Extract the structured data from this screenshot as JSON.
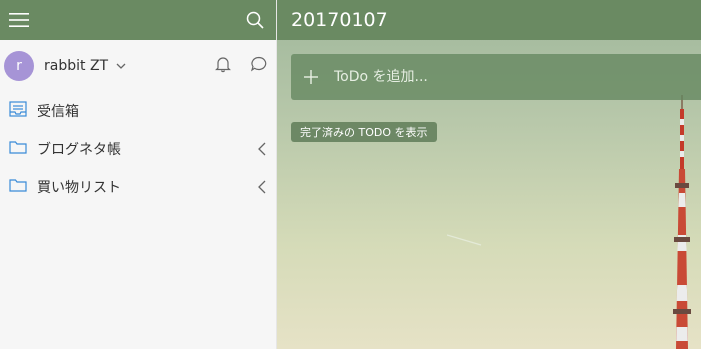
{
  "sidebar": {
    "user": {
      "initial": "r",
      "name": "rabbit ZT"
    },
    "items": [
      {
        "label": "受信箱",
        "icon": "inbox-icon"
      },
      {
        "label": "ブログネタ帳",
        "icon": "folder-icon"
      },
      {
        "label": "買い物リスト",
        "icon": "folder-icon"
      }
    ]
  },
  "main": {
    "title": "20170107",
    "add_placeholder": "ToDo を追加...",
    "show_completed": "完了済みの TODO を表示"
  },
  "colors": {
    "header_green": "#6a8a62",
    "avatar": "#a694d6",
    "folder_blue": "#3a8bd8"
  }
}
